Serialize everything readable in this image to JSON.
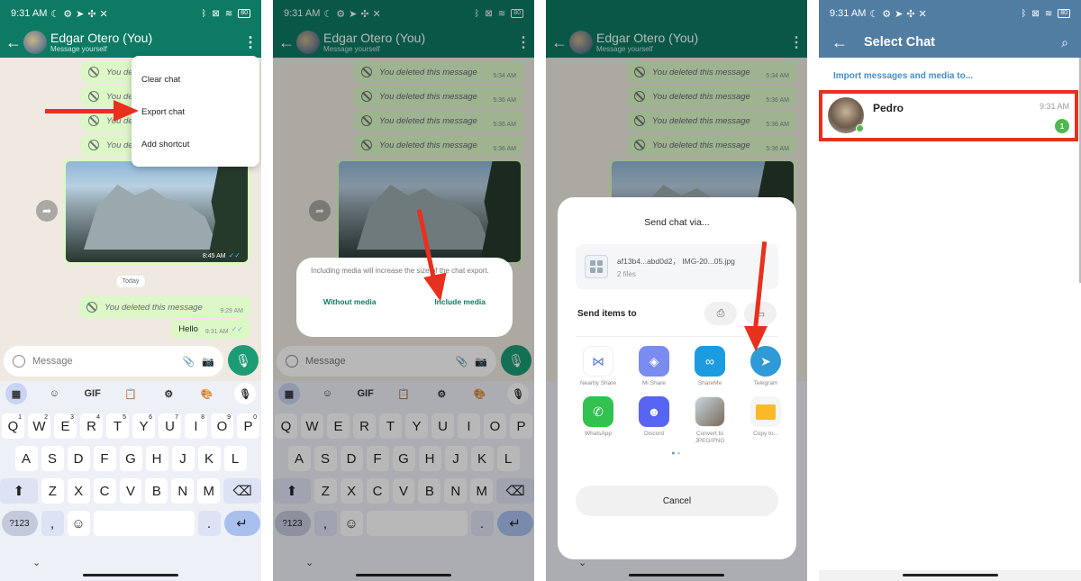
{
  "status_bar": {
    "time": "9:31 AM",
    "left_icons": [
      "moon-icon",
      "sync-off-icon",
      "telegram-icon",
      "fan-icon",
      "x-icon"
    ],
    "right_icons": [
      "bluetooth-icon",
      "sim-off-icon",
      "wifi-icon"
    ],
    "battery": "80"
  },
  "whatsapp": {
    "contact_name": "Edgar Otero (You)",
    "contact_subtitle": "Message yourself",
    "messages": [
      {
        "text": "You deleted this message",
        "time": "5:34 AM"
      },
      {
        "text": "You deleted this message",
        "time": "5:36 AM"
      },
      {
        "text": "You deleted this message",
        "time": "5:36 AM"
      },
      {
        "text": "You deleted this message",
        "time": "5:36 AM"
      }
    ],
    "photo_time": "8:45 AM",
    "date_chip": "Today",
    "deleted_today": {
      "text": "You deleted this message",
      "time": "9:29 AM"
    },
    "hello": {
      "text": "Hello",
      "time": "9:31 AM"
    },
    "input_placeholder": "Message"
  },
  "menu": {
    "items": [
      "Clear chat",
      "Export chat",
      "Add shortcut"
    ]
  },
  "keyboard": {
    "tools": [
      "apps-icon",
      "sticker-icon",
      "GIF",
      "clipboard-icon",
      "settings-icon",
      "palette-icon",
      "mic-icon"
    ],
    "row1": [
      [
        "Q",
        "1"
      ],
      [
        "W",
        "2"
      ],
      [
        "E",
        "3"
      ],
      [
        "R",
        "4"
      ],
      [
        "T",
        "5"
      ],
      [
        "Y",
        "6"
      ],
      [
        "U",
        "7"
      ],
      [
        "I",
        "8"
      ],
      [
        "O",
        "9"
      ],
      [
        "P",
        "0"
      ]
    ],
    "row2": [
      "A",
      "S",
      "D",
      "F",
      "G",
      "H",
      "J",
      "K",
      "L"
    ],
    "row3": [
      "Z",
      "X",
      "C",
      "V",
      "B",
      "N",
      "M"
    ],
    "num_key": "?123",
    "comma": ",",
    "period": "."
  },
  "export_dialog": {
    "message": "Including media will increase the size of the chat export.",
    "without_media": "Without media",
    "include_media": "Include media"
  },
  "share_sheet": {
    "title": "Send chat via...",
    "file_name": "af13b4...abd0d2， IMG-20...05.jpg",
    "file_count": "2 files",
    "send_items_to": "Send items to",
    "apps": [
      {
        "label": "Nearby Share",
        "color": "#ffffff",
        "icon": "nearby-share-icon"
      },
      {
        "label": "Mi Share",
        "color": "#7b8cf0",
        "icon": "mi-share-icon"
      },
      {
        "label": "ShareMe",
        "color": "#1d9be0",
        "icon": "shareme-icon"
      },
      {
        "label": "Telegram",
        "color": "#2e9ad7",
        "icon": "telegram-icon"
      },
      {
        "label": "WhatsApp",
        "color": "#33c14f",
        "icon": "whatsapp-icon"
      },
      {
        "label": "Discord",
        "color": "#5865f2",
        "icon": "discord-icon"
      },
      {
        "label": "Convert to JPEG/PNG",
        "color": "#ffffff",
        "icon": "convert-image-icon"
      },
      {
        "label": "Copy to...",
        "color": "#f5f5f5",
        "icon": "folder-icon"
      }
    ],
    "cancel": "Cancel"
  },
  "telegram": {
    "title": "Select Chat",
    "import_label": "Import messages and media to...",
    "chat": {
      "name": "Pedro",
      "time": "9:31 AM",
      "unread": "1"
    }
  },
  "colors": {
    "whatsapp_green": "#0d7a63",
    "telegram_blue": "#527da3",
    "highlight_red": "#e8301e"
  }
}
